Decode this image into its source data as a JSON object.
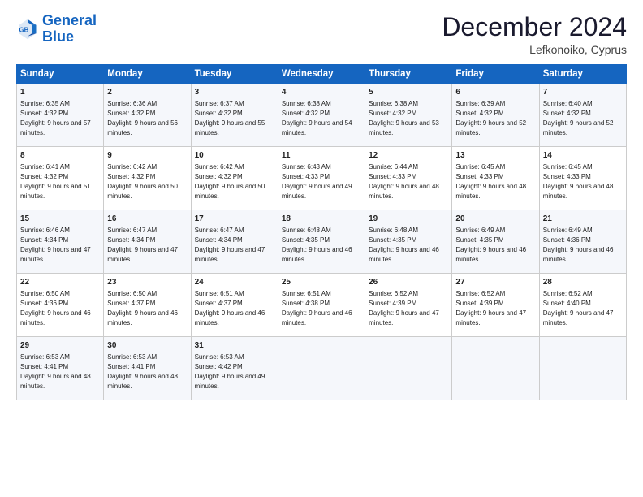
{
  "logo": {
    "line1": "General",
    "line2": "Blue"
  },
  "title": "December 2024",
  "subtitle": "Lefkonoiko, Cyprus",
  "headers": [
    "Sunday",
    "Monday",
    "Tuesday",
    "Wednesday",
    "Thursday",
    "Friday",
    "Saturday"
  ],
  "weeks": [
    [
      {
        "day": "1",
        "sunrise": "Sunrise: 6:35 AM",
        "sunset": "Sunset: 4:32 PM",
        "daylight": "Daylight: 9 hours and 57 minutes."
      },
      {
        "day": "2",
        "sunrise": "Sunrise: 6:36 AM",
        "sunset": "Sunset: 4:32 PM",
        "daylight": "Daylight: 9 hours and 56 minutes."
      },
      {
        "day": "3",
        "sunrise": "Sunrise: 6:37 AM",
        "sunset": "Sunset: 4:32 PM",
        "daylight": "Daylight: 9 hours and 55 minutes."
      },
      {
        "day": "4",
        "sunrise": "Sunrise: 6:38 AM",
        "sunset": "Sunset: 4:32 PM",
        "daylight": "Daylight: 9 hours and 54 minutes."
      },
      {
        "day": "5",
        "sunrise": "Sunrise: 6:38 AM",
        "sunset": "Sunset: 4:32 PM",
        "daylight": "Daylight: 9 hours and 53 minutes."
      },
      {
        "day": "6",
        "sunrise": "Sunrise: 6:39 AM",
        "sunset": "Sunset: 4:32 PM",
        "daylight": "Daylight: 9 hours and 52 minutes."
      },
      {
        "day": "7",
        "sunrise": "Sunrise: 6:40 AM",
        "sunset": "Sunset: 4:32 PM",
        "daylight": "Daylight: 9 hours and 52 minutes."
      }
    ],
    [
      {
        "day": "8",
        "sunrise": "Sunrise: 6:41 AM",
        "sunset": "Sunset: 4:32 PM",
        "daylight": "Daylight: 9 hours and 51 minutes."
      },
      {
        "day": "9",
        "sunrise": "Sunrise: 6:42 AM",
        "sunset": "Sunset: 4:32 PM",
        "daylight": "Daylight: 9 hours and 50 minutes."
      },
      {
        "day": "10",
        "sunrise": "Sunrise: 6:42 AM",
        "sunset": "Sunset: 4:32 PM",
        "daylight": "Daylight: 9 hours and 50 minutes."
      },
      {
        "day": "11",
        "sunrise": "Sunrise: 6:43 AM",
        "sunset": "Sunset: 4:33 PM",
        "daylight": "Daylight: 9 hours and 49 minutes."
      },
      {
        "day": "12",
        "sunrise": "Sunrise: 6:44 AM",
        "sunset": "Sunset: 4:33 PM",
        "daylight": "Daylight: 9 hours and 48 minutes."
      },
      {
        "day": "13",
        "sunrise": "Sunrise: 6:45 AM",
        "sunset": "Sunset: 4:33 PM",
        "daylight": "Daylight: 9 hours and 48 minutes."
      },
      {
        "day": "14",
        "sunrise": "Sunrise: 6:45 AM",
        "sunset": "Sunset: 4:33 PM",
        "daylight": "Daylight: 9 hours and 48 minutes."
      }
    ],
    [
      {
        "day": "15",
        "sunrise": "Sunrise: 6:46 AM",
        "sunset": "Sunset: 4:34 PM",
        "daylight": "Daylight: 9 hours and 47 minutes."
      },
      {
        "day": "16",
        "sunrise": "Sunrise: 6:47 AM",
        "sunset": "Sunset: 4:34 PM",
        "daylight": "Daylight: 9 hours and 47 minutes."
      },
      {
        "day": "17",
        "sunrise": "Sunrise: 6:47 AM",
        "sunset": "Sunset: 4:34 PM",
        "daylight": "Daylight: 9 hours and 47 minutes."
      },
      {
        "day": "18",
        "sunrise": "Sunrise: 6:48 AM",
        "sunset": "Sunset: 4:35 PM",
        "daylight": "Daylight: 9 hours and 46 minutes."
      },
      {
        "day": "19",
        "sunrise": "Sunrise: 6:48 AM",
        "sunset": "Sunset: 4:35 PM",
        "daylight": "Daylight: 9 hours and 46 minutes."
      },
      {
        "day": "20",
        "sunrise": "Sunrise: 6:49 AM",
        "sunset": "Sunset: 4:35 PM",
        "daylight": "Daylight: 9 hours and 46 minutes."
      },
      {
        "day": "21",
        "sunrise": "Sunrise: 6:49 AM",
        "sunset": "Sunset: 4:36 PM",
        "daylight": "Daylight: 9 hours and 46 minutes."
      }
    ],
    [
      {
        "day": "22",
        "sunrise": "Sunrise: 6:50 AM",
        "sunset": "Sunset: 4:36 PM",
        "daylight": "Daylight: 9 hours and 46 minutes."
      },
      {
        "day": "23",
        "sunrise": "Sunrise: 6:50 AM",
        "sunset": "Sunset: 4:37 PM",
        "daylight": "Daylight: 9 hours and 46 minutes."
      },
      {
        "day": "24",
        "sunrise": "Sunrise: 6:51 AM",
        "sunset": "Sunset: 4:37 PM",
        "daylight": "Daylight: 9 hours and 46 minutes."
      },
      {
        "day": "25",
        "sunrise": "Sunrise: 6:51 AM",
        "sunset": "Sunset: 4:38 PM",
        "daylight": "Daylight: 9 hours and 46 minutes."
      },
      {
        "day": "26",
        "sunrise": "Sunrise: 6:52 AM",
        "sunset": "Sunset: 4:39 PM",
        "daylight": "Daylight: 9 hours and 47 minutes."
      },
      {
        "day": "27",
        "sunrise": "Sunrise: 6:52 AM",
        "sunset": "Sunset: 4:39 PM",
        "daylight": "Daylight: 9 hours and 47 minutes."
      },
      {
        "day": "28",
        "sunrise": "Sunrise: 6:52 AM",
        "sunset": "Sunset: 4:40 PM",
        "daylight": "Daylight: 9 hours and 47 minutes."
      }
    ],
    [
      {
        "day": "29",
        "sunrise": "Sunrise: 6:53 AM",
        "sunset": "Sunset: 4:41 PM",
        "daylight": "Daylight: 9 hours and 48 minutes."
      },
      {
        "day": "30",
        "sunrise": "Sunrise: 6:53 AM",
        "sunset": "Sunset: 4:41 PM",
        "daylight": "Daylight: 9 hours and 48 minutes."
      },
      {
        "day": "31",
        "sunrise": "Sunrise: 6:53 AM",
        "sunset": "Sunset: 4:42 PM",
        "daylight": "Daylight: 9 hours and 49 minutes."
      },
      null,
      null,
      null,
      null
    ]
  ]
}
